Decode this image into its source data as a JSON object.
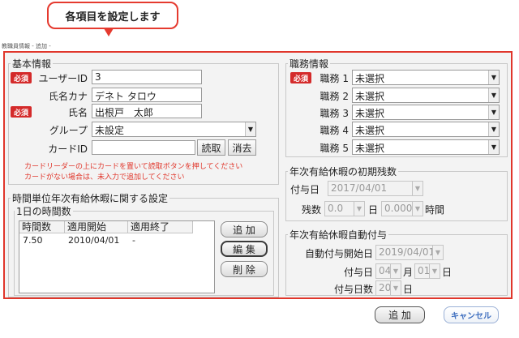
{
  "callout": {
    "text": "各項目を設定します"
  },
  "window_title": "教職員情報 - 追加 -",
  "basic_info": {
    "legend": "基本情報",
    "required_badge": "必須",
    "user_id_label": "ユーザーID",
    "user_id_value": "3",
    "name_kana_label": "氏名カナ",
    "name_kana_value": "デネト タロウ",
    "name_label": "氏名",
    "name_value": "出根戸　太郎",
    "group_label": "グループ",
    "group_value": "未設定",
    "card_id_label": "カードID",
    "card_id_value": "",
    "read_button": "読取",
    "erase_button": "消去",
    "hint_line1": "カードリーダーの上にカードを置いて読取ボタンを押してください",
    "hint_line2": "カードがない場合は、未入力で追加してください"
  },
  "duty_info": {
    "legend": "職務情報",
    "required_badge": "必須",
    "duties": [
      {
        "label": "職務 1",
        "value": "未選択"
      },
      {
        "label": "職務 2",
        "value": "未選択"
      },
      {
        "label": "職務 3",
        "value": "未選択"
      },
      {
        "label": "職務 4",
        "value": "未選択"
      },
      {
        "label": "職務 5",
        "value": "未選択"
      }
    ]
  },
  "hourly_leave": {
    "legend": "時間単位年次有給休暇に関する設定",
    "daily_hours_legend": "1日の時間数",
    "columns": [
      "時間数",
      "適用開始",
      "適用終了"
    ],
    "rows": [
      {
        "hours": "7.50",
        "start": "2010/04/01",
        "end": "-"
      }
    ],
    "add_button": "追 加",
    "edit_button": "編 集",
    "delete_button": "削 除"
  },
  "initial_leave": {
    "legend": "年次有給休暇の初期残数",
    "grant_date_label": "付与日",
    "grant_date_value": "2017/04/01",
    "remaining_label": "残数",
    "days_value": "0.0",
    "days_unit": "日",
    "hours_value": "0.000",
    "hours_unit": "時間"
  },
  "auto_grant": {
    "legend": "年次有給休暇自動付与",
    "start_date_label": "自動付与開始日",
    "start_date_value": "2019/04/01",
    "grant_day_label": "付与日",
    "month_value": "04",
    "month_unit": "月",
    "day_value": "01",
    "day_unit": "日",
    "grant_days_label": "付与日数",
    "grant_days_value": "20",
    "grant_days_unit": "日"
  },
  "footer": {
    "add_button": "追 加",
    "cancel_button": "キャンセル"
  },
  "colors": {
    "accent_red": "#e0362b",
    "required_badge": "#d42a2a",
    "cancel_text": "#3f6fbf"
  }
}
